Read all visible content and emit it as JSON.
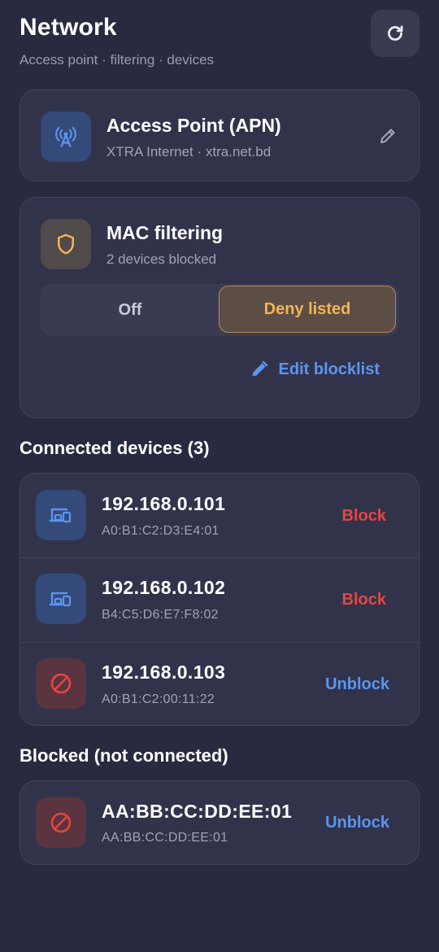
{
  "header": {
    "title": "Network",
    "subtitle": "Access point · filtering · devices",
    "refresh_icon": "refresh-icon"
  },
  "apn": {
    "title": "Access Point (APN)",
    "detail": "XTRA Internet · xtra.net.bd",
    "icon": "antenna-icon",
    "edit_icon": "pencil-icon"
  },
  "mac_filtering": {
    "title": "MAC filtering",
    "status": "2 devices blocked",
    "icon": "shield-icon",
    "options": [
      "Off",
      "Deny listed"
    ],
    "selected": "Deny listed",
    "edit_label": "Edit blocklist"
  },
  "connected": {
    "section_title": "Connected devices (3)",
    "devices": [
      {
        "ip": "192.168.0.101",
        "mac": "A0:B1:C2:D3:E4:01",
        "action": "Block",
        "icon": "devices-icon"
      },
      {
        "ip": "192.168.0.102",
        "mac": "B4:C5:D6:E7:F8:02",
        "action": "Block",
        "icon": "devices-icon"
      },
      {
        "ip": "192.168.0.103",
        "mac": "A0:B1:C2:00:11:22",
        "action": "Unblock",
        "icon": "blocked-icon"
      }
    ]
  },
  "blocked": {
    "section_title": "Blocked (not connected)",
    "devices": [
      {
        "name": "AA:BB:CC:DD:EE:01",
        "mac": "AA:BB:CC:DD:EE:01",
        "action": "Unblock",
        "icon": "blocked-icon"
      }
    ]
  },
  "colors": {
    "background": "#282a40",
    "card": "#31334b",
    "accent_blue": "#5c95f0",
    "accent_amber": "#f3b458",
    "danger_red": "#e6463f"
  }
}
